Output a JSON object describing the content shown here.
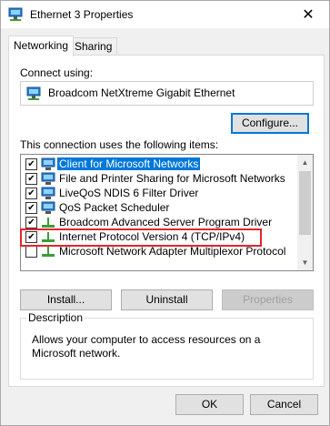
{
  "window": {
    "title": "Ethernet 3 Properties",
    "close_glyph": "✕"
  },
  "tabs": [
    {
      "label": "Networking"
    },
    {
      "label": "Sharing"
    }
  ],
  "connect_using": {
    "label": "Connect using:",
    "adapter_name": "Broadcom NetXtreme Gigabit Ethernet",
    "adapter_icon": "network-adapter-icon",
    "configure_label": "Configure..."
  },
  "items_label": "This connection uses the following items:",
  "items": [
    {
      "label": "Client for Microsoft Networks",
      "checked": true,
      "selected": true,
      "icon": "network-client-icon"
    },
    {
      "label": "File and Printer Sharing for Microsoft Networks",
      "checked": true,
      "selected": false,
      "icon": "network-service-icon"
    },
    {
      "label": "LiveQoS NDIS 6 Filter Driver",
      "checked": true,
      "selected": false,
      "icon": "network-service-icon"
    },
    {
      "label": "QoS Packet Scheduler",
      "checked": true,
      "selected": false,
      "icon": "network-service-icon"
    },
    {
      "label": "Broadcom Advanced Server Program Driver",
      "checked": true,
      "selected": false,
      "icon": "protocol-icon"
    },
    {
      "label": "Internet Protocol Version 4 (TCP/IPv4)",
      "checked": true,
      "selected": false,
      "icon": "protocol-icon"
    },
    {
      "label": "Microsoft Network Adapter Multiplexor Protocol",
      "checked": false,
      "selected": false,
      "icon": "protocol-icon"
    }
  ],
  "buttons": {
    "install": "Install...",
    "uninstall": "Uninstall",
    "properties": "Properties"
  },
  "description": {
    "title": "Description",
    "text": "Allows your computer to access resources on a Microsoft network."
  },
  "footer": {
    "ok": "OK",
    "cancel": "Cancel"
  },
  "colors": {
    "selection": "#0078d7",
    "highlight_box": "#e3262c"
  }
}
